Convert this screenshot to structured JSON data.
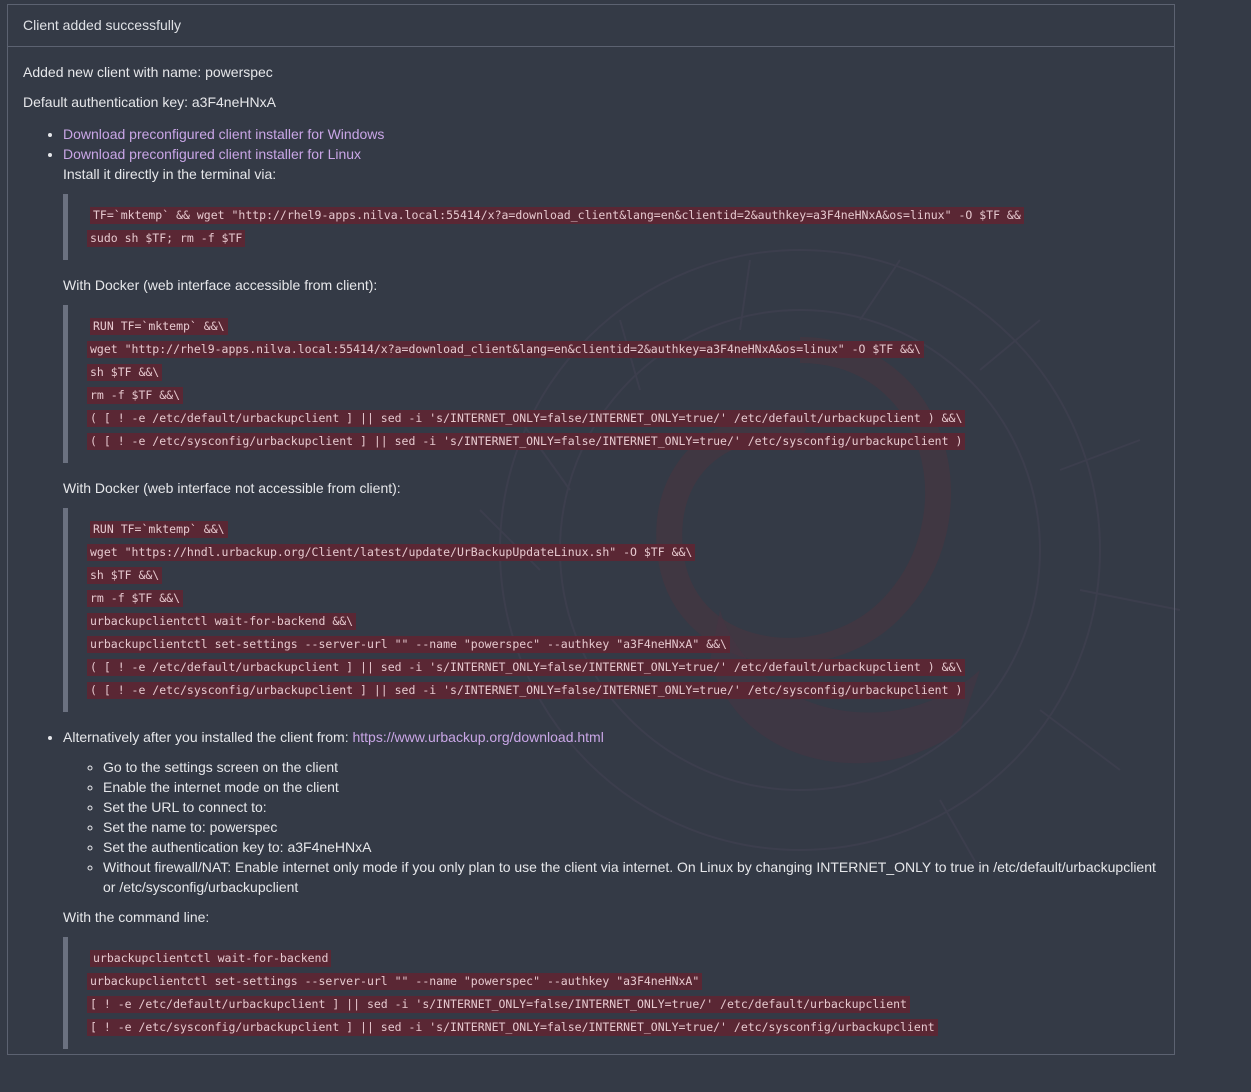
{
  "panel": {
    "heading": "Client added successfully",
    "added_text": "Added new client with name: powerspec",
    "auth_text": "Default authentication key: a3F4neHNxA"
  },
  "links": {
    "windows": "Download preconfigured client installer for Windows",
    "linux": "Download preconfigured client installer for Linux"
  },
  "terminal": {
    "label": "Install it directly in the terminal via:",
    "lines": [
      "TF=`mktemp` && wget \"http://rhel9-apps.nilva.local:55414/x?a=download_client&lang=en&clientid=2&authkey=a3F4neHNxA&os=linux\" -O $TF &&",
      "sudo sh $TF; rm -f $TF"
    ]
  },
  "docker_accessible": {
    "label": "With Docker (web interface accessible from client):",
    "lines": [
      "RUN TF=`mktemp` &&\\",
      "wget \"http://rhel9-apps.nilva.local:55414/x?a=download_client&lang=en&clientid=2&authkey=a3F4neHNxA&os=linux\" -O $TF &&\\",
      "sh $TF &&\\",
      "rm -f $TF &&\\",
      "( [ ! -e /etc/default/urbackupclient ] || sed -i 's/INTERNET_ONLY=false/INTERNET_ONLY=true/' /etc/default/urbackupclient ) &&\\",
      "( [ ! -e /etc/sysconfig/urbackupclient ] || sed -i 's/INTERNET_ONLY=false/INTERNET_ONLY=true/' /etc/sysconfig/urbackupclient )"
    ]
  },
  "docker_not_accessible": {
    "label": "With Docker (web interface not accessible from client):",
    "lines": [
      "RUN TF=`mktemp` &&\\",
      "wget \"https://hndl.urbackup.org/Client/latest/update/UrBackupUpdateLinux.sh\" -O $TF &&\\",
      "sh $TF &&\\",
      "rm -f $TF &&\\",
      "urbackupclientctl wait-for-backend &&\\",
      "urbackupclientctl set-settings --server-url \"\" --name \"powerspec\" --authkey \"a3F4neHNxA\" &&\\",
      "( [ ! -e /etc/default/urbackupclient ] || sed -i 's/INTERNET_ONLY=false/INTERNET_ONLY=true/' /etc/default/urbackupclient ) &&\\",
      "( [ ! -e /etc/sysconfig/urbackupclient ] || sed -i 's/INTERNET_ONLY=false/INTERNET_ONLY=true/' /etc/sysconfig/urbackupclient )"
    ]
  },
  "alternative": {
    "prefix": "Alternatively after you installed the client from: ",
    "url": "https://www.urbackup.org/download.html",
    "steps": [
      "Go to the settings screen on the client",
      "Enable the internet mode on the client",
      "Set the URL to connect to:",
      "Set the name to: powerspec",
      "Set the authentication key to: a3F4neHNxA",
      "Without firewall/NAT: Enable internet only mode if you only plan to use the client via internet. On Linux by changing INTERNET_ONLY to true in /etc/default/urbackupclient or /etc/sysconfig/urbackupclient"
    ],
    "cmd_label": "With the command line:",
    "cmd_lines": [
      "urbackupclientctl wait-for-backend",
      "urbackupclientctl set-settings --server-url \"\" --name \"powerspec\" --authkey \"a3F4neHNxA\"",
      "[ ! -e /etc/default/urbackupclient ] || sed -i 's/INTERNET_ONLY=false/INTERNET_ONLY=true/' /etc/default/urbackupclient",
      "[ ! -e /etc/sysconfig/urbackupclient ] || sed -i 's/INTERNET_ONLY=false/INTERNET_ONLY=true/' /etc/sysconfig/urbackupclient"
    ]
  },
  "colors": {
    "background": "#343a46",
    "link": "#c9a6e6",
    "code_bg": "#5a2734",
    "code_text": "#e6c9cf"
  }
}
